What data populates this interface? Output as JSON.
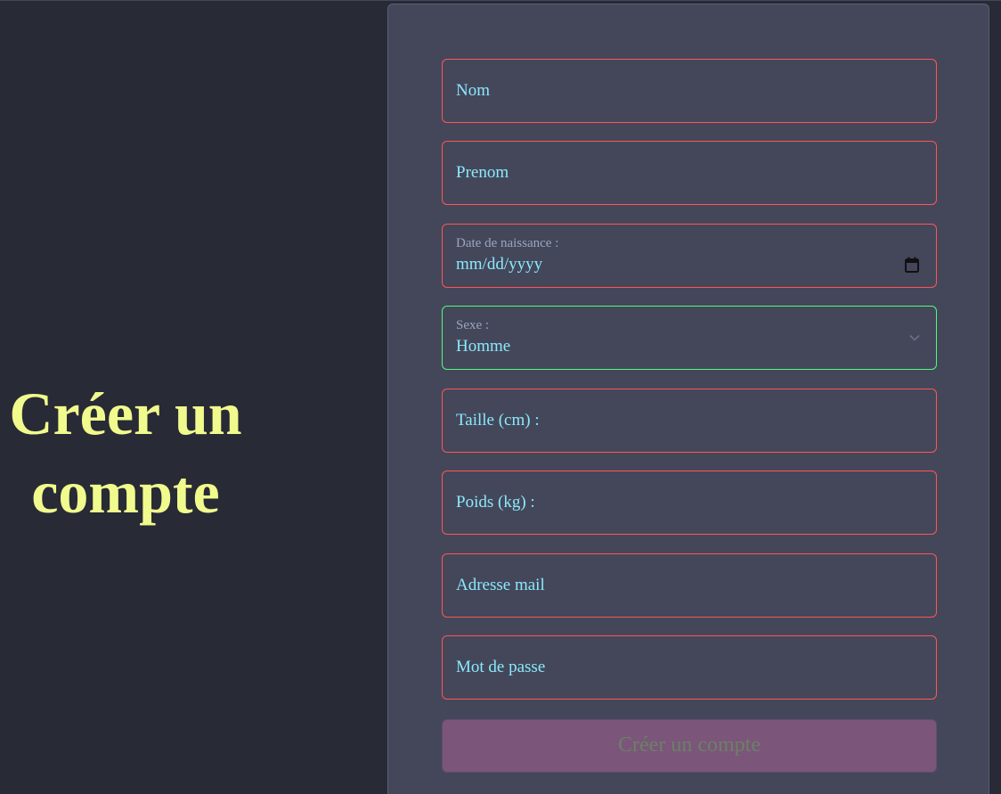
{
  "hero": {
    "title": "Créer un compte"
  },
  "form": {
    "nom": {
      "placeholder": "Nom"
    },
    "prenom": {
      "placeholder": "Prenom"
    },
    "date_naissance": {
      "label": "Date de naissance :",
      "value": "mm/dd/yyyy"
    },
    "sexe": {
      "label": "Sexe :",
      "value": "Homme"
    },
    "taille": {
      "placeholder": "Taille (cm) :"
    },
    "poids": {
      "placeholder": "Poids (kg) :"
    },
    "email": {
      "placeholder": "Adresse mail"
    },
    "password": {
      "placeholder": "Mot de passe"
    },
    "submit_label": "Créer un compte"
  },
  "icons": {
    "date": "calendar-icon",
    "select": "chevron-down-icon"
  },
  "colors": {
    "background": "#282a36",
    "panel": "#44475a",
    "title": "#f1fa8c",
    "text": "#8be9fd",
    "invalid_border": "#ff5555",
    "valid_border": "#50fa7b",
    "button": "#7b557a"
  }
}
